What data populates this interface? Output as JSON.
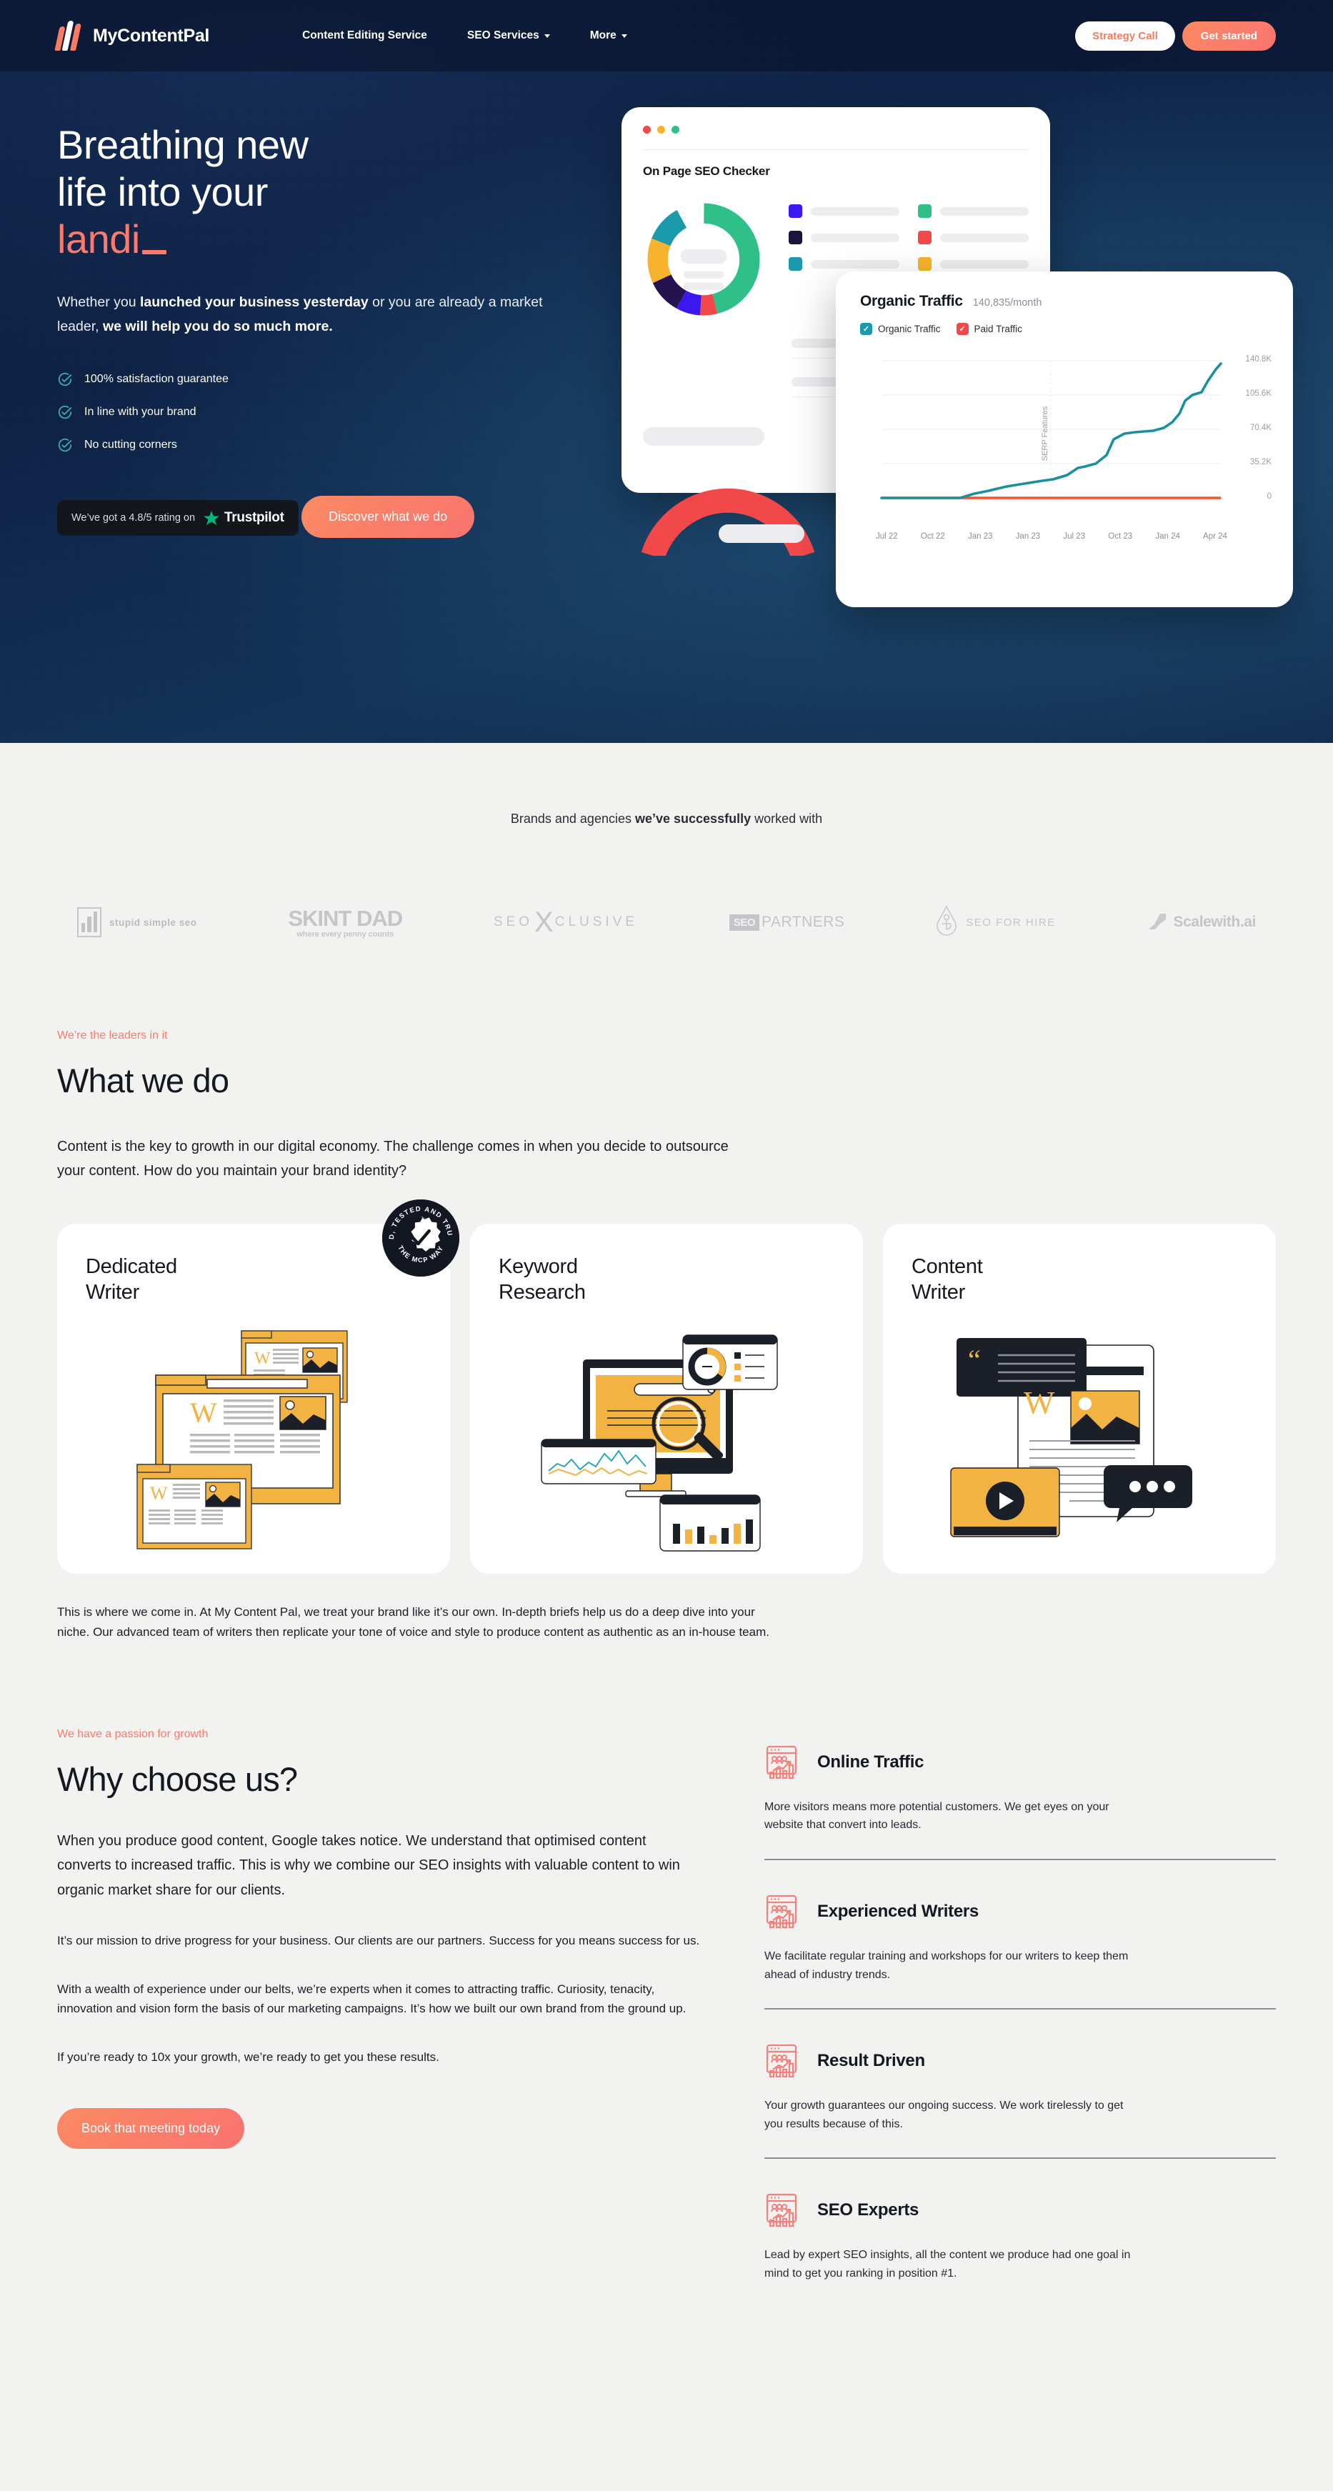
{
  "nav": {
    "brand": "MyContentPal",
    "links": [
      {
        "label": "Content Editing Service",
        "caret": false
      },
      {
        "label": "SEO Services",
        "caret": true
      },
      {
        "label": "More",
        "caret": true
      }
    ],
    "strategy_call": "Strategy Call",
    "get_started": "Get started"
  },
  "hero": {
    "title_line1": "Breathing new",
    "title_line2": "life into your",
    "title_accent": "landi",
    "sub_1": "Whether you ",
    "sub_2": "launched your business yesterday",
    "sub_3": " or you are already a market leader, ",
    "sub_4": "we will help you do so much more.",
    "checks": [
      "100% satisfaction guarantee",
      "In line with your brand",
      "No cutting corners"
    ],
    "trust_text": "We’ve got a  4.8/5 rating on",
    "trust_brand": "Trustpilot",
    "cta": "Discover what we do",
    "mock_a": {
      "title": "On Page SEO Checker",
      "legend_colors": [
        "#3b18f0",
        "#1b1240",
        "#1a9aaa",
        "#2fc08a",
        "#f3484a",
        "#f7b32b"
      ],
      "donut_segments": [
        {
          "color": "#2fc08a",
          "value": 46
        },
        {
          "color": "#f3484a",
          "value": 5
        },
        {
          "color": "#3b18f0",
          "value": 7
        },
        {
          "color": "#24134f",
          "value": 10
        },
        {
          "color": "#f7b32b",
          "value": 13
        },
        {
          "color": "#1a9aaa",
          "value": 11
        },
        {
          "color": "#2fc08a",
          "value": 8
        }
      ]
    },
    "mock_b": {
      "title": "Organic Traffic",
      "value": "140,835/month",
      "legend": [
        {
          "label": "Organic Traffic",
          "color": "#1a9aaa"
        },
        {
          "label": "Paid Traffic",
          "color": "#f3484a"
        }
      ],
      "y_axis_label": "SERP Features",
      "y_ticks": [
        "140.8K",
        "105.6K",
        "70.4K",
        "35.2K",
        "0"
      ],
      "x_ticks": [
        "Jul 22",
        "Oct 22",
        "Jan 23",
        "Jan 23",
        "Jul 23",
        "Oct 23",
        "Jan 24",
        "Apr 24"
      ]
    }
  },
  "brands": {
    "title_1": "Brands and agencies ",
    "title_2": "we’ve successfully",
    "title_3": " worked with",
    "logos": [
      {
        "name": "stupid simple seo",
        "kind": "ssbox"
      },
      {
        "name": "SKINT DAD",
        "tagline": "where every penny counts",
        "kind": "skint"
      },
      {
        "name": "SEOXCLUSIVE",
        "kind": "seox"
      },
      {
        "name": "SEOPARTNERS",
        "kind": "seopartners"
      },
      {
        "name": "SEO FOR HIRE",
        "kind": "seoforhire"
      },
      {
        "name": "Scalewith.ai",
        "kind": "scalewith"
      }
    ]
  },
  "what_we_do": {
    "eyebrow": "We’re the leaders in it",
    "heading": "What we do",
    "lead": "Content is the key to growth in our digital economy. The challenge comes in when you decide to outsource your content. How do you maintain your brand identity?",
    "cards": [
      {
        "title_line1": "Dedicated",
        "title_line2": "Writer",
        "illo": "browser-windows-illustration"
      },
      {
        "title_line1": "Keyword",
        "title_line2": "Research",
        "illo": "monitor-search-illustration"
      },
      {
        "title_line1": "Content",
        "title_line2": "Writer",
        "illo": "document-chat-video-illustration"
      }
    ],
    "badge_top": "TRIED, TESTED AND TRUSTED",
    "badge_bottom": "THE MCP WAY",
    "after": "This is where we come in. At My Content Pal, we treat your brand like it’s our own. In-depth briefs help us do a deep dive into your niche. Our advanced team of writers then replicate your tone of voice and style to produce content as authentic as an in-house team."
  },
  "why": {
    "eyebrow": "We have a passion for growth",
    "heading": "Why choose us?",
    "paragraphs": [
      "When you produce good content, Google takes notice. We understand that optimised content converts to increased traffic. This is why we combine our SEO insights with valuable content to win organic market share for our clients.",
      "It’s our mission to drive progress for your business. Our clients are our partners. Success for you means success for us.",
      "With a wealth of experience under our belts, we’re experts when it comes to attracting traffic. Curiosity, tenacity, innovation and vision form the basis of our marketing campaigns. It’s how we built our own brand from the ground up.",
      "If you’re ready to 10x your growth, we’re ready to get you these results."
    ],
    "cta": "Book that meeting today",
    "features": [
      {
        "title": "Online Traffic",
        "body": "More visitors means more potential customers. We get eyes on your website that convert into leads."
      },
      {
        "title": "Experienced Writers",
        "body": "We facilitate regular training and workshops for our writers to keep them ahead of industry trends."
      },
      {
        "title": "Result Driven",
        "body": "Your growth guarantees our ongoing success. We work tirelessly to get you results because of this."
      },
      {
        "title": "SEO Experts",
        "body": "Lead by expert SEO insights, all the content we produce had one goal in mind to get you ranking in position #1."
      }
    ]
  },
  "colors": {
    "accent": "#fb7a6c",
    "accent_orange": "#fb8a63",
    "navy": "#0d2145",
    "teal": "#1a9aaa",
    "yellow": "#f7b32b",
    "page_bg": "#f2f2f0"
  },
  "chart_data": {
    "type": "line",
    "title": "Organic Traffic",
    "subtitle": "140,835/month",
    "ylabel": "SERP Features",
    "xlabel": "",
    "ylim": [
      0,
      140800
    ],
    "y_ticks": [
      0,
      35200,
      70400,
      105600,
      140800
    ],
    "x": [
      "Jul 22",
      "Oct 22",
      "Jan 23",
      "Jan 23",
      "Jul 23",
      "Oct 23",
      "Jan 24",
      "Apr 24"
    ],
    "series": [
      {
        "name": "Organic Traffic",
        "color": "#1a9aaa",
        "values": [
          0,
          1500,
          14000,
          22000,
          33000,
          72000,
          96000,
          140800
        ]
      },
      {
        "name": "Paid Traffic",
        "color": "#f3484a",
        "values": [
          0,
          0,
          0,
          0,
          0,
          0,
          0,
          0
        ]
      }
    ],
    "legend_position": "top-left",
    "grid": true
  }
}
